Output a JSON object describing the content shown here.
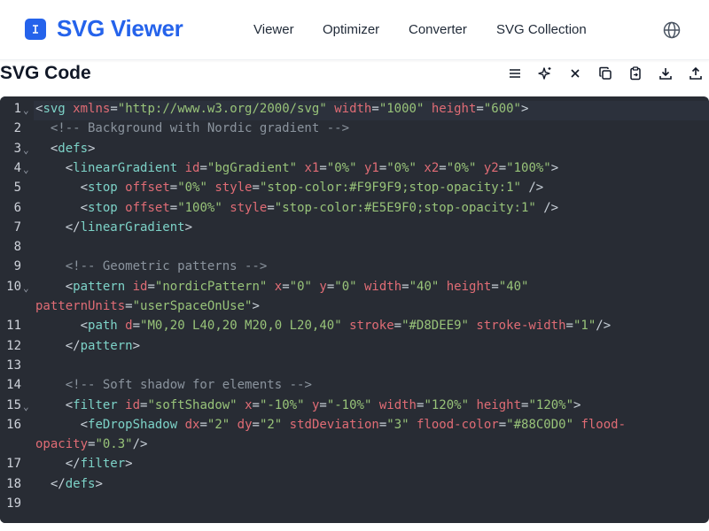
{
  "header": {
    "brand": "SVG Viewer",
    "nav": [
      "Viewer",
      "Optimizer",
      "Converter",
      "SVG Collection"
    ],
    "language_icon": "globe-icon"
  },
  "toolbar": {
    "title": "SVG Code",
    "icons": [
      "menu-icon",
      "sparkles-icon",
      "close-icon",
      "copy-icon",
      "paste-icon",
      "download-icon",
      "upload-icon"
    ]
  },
  "editor": {
    "lines": [
      {
        "n": "1",
        "fold": true
      },
      {
        "n": "2",
        "fold": false
      },
      {
        "n": "3",
        "fold": true
      },
      {
        "n": "4",
        "fold": true
      },
      {
        "n": "5",
        "fold": false
      },
      {
        "n": "6",
        "fold": false
      },
      {
        "n": "7",
        "fold": false
      },
      {
        "n": "8",
        "fold": false
      },
      {
        "n": "9",
        "fold": false
      },
      {
        "n": "10",
        "fold": true
      },
      {
        "n": "11",
        "fold": false
      },
      {
        "n": "12",
        "fold": false
      },
      {
        "n": "13",
        "fold": false
      },
      {
        "n": "14",
        "fold": false
      },
      {
        "n": "15",
        "fold": true
      },
      {
        "n": "16",
        "fold": false
      },
      {
        "n": "17",
        "fold": false
      },
      {
        "n": "18",
        "fold": false
      },
      {
        "n": "19",
        "fold": false
      }
    ],
    "code": [
      [
        [
          "p",
          "<"
        ],
        [
          "tag",
          "svg"
        ],
        [
          "p",
          " "
        ],
        [
          "attr",
          "xmlns"
        ],
        [
          "p",
          "="
        ],
        [
          "str",
          "\"http://www.w3.org/2000/svg\""
        ],
        [
          "p",
          " "
        ],
        [
          "attr",
          "width"
        ],
        [
          "p",
          "="
        ],
        [
          "str",
          "\"1000\""
        ],
        [
          "p",
          " "
        ],
        [
          "attr",
          "height"
        ],
        [
          "p",
          "="
        ],
        [
          "str",
          "\"600\""
        ],
        [
          "p",
          ">"
        ]
      ],
      [
        [
          "p",
          "  "
        ],
        [
          "cmt",
          "<!-- Background with Nordic gradient -->"
        ]
      ],
      [
        [
          "p",
          "  <"
        ],
        [
          "tag",
          "defs"
        ],
        [
          "p",
          ">"
        ]
      ],
      [
        [
          "p",
          "    <"
        ],
        [
          "tag",
          "linearGradient"
        ],
        [
          "p",
          " "
        ],
        [
          "attr",
          "id"
        ],
        [
          "p",
          "="
        ],
        [
          "str",
          "\"bgGradient\""
        ],
        [
          "p",
          " "
        ],
        [
          "attr",
          "x1"
        ],
        [
          "p",
          "="
        ],
        [
          "str",
          "\"0%\""
        ],
        [
          "p",
          " "
        ],
        [
          "attr",
          "y1"
        ],
        [
          "p",
          "="
        ],
        [
          "str",
          "\"0%\""
        ],
        [
          "p",
          " "
        ],
        [
          "attr",
          "x2"
        ],
        [
          "p",
          "="
        ],
        [
          "str",
          "\"0%\""
        ],
        [
          "p",
          " "
        ],
        [
          "attr",
          "y2"
        ],
        [
          "p",
          "="
        ],
        [
          "str",
          "\"100%\""
        ],
        [
          "p",
          ">"
        ]
      ],
      [
        [
          "p",
          "      <"
        ],
        [
          "tag",
          "stop"
        ],
        [
          "p",
          " "
        ],
        [
          "attr",
          "offset"
        ],
        [
          "p",
          "="
        ],
        [
          "str",
          "\"0%\""
        ],
        [
          "p",
          " "
        ],
        [
          "attr",
          "style"
        ],
        [
          "p",
          "="
        ],
        [
          "str",
          "\"stop-color:#F9F9F9;stop-opacity:1\""
        ],
        [
          "p",
          " />"
        ]
      ],
      [
        [
          "p",
          "      <"
        ],
        [
          "tag",
          "stop"
        ],
        [
          "p",
          " "
        ],
        [
          "attr",
          "offset"
        ],
        [
          "p",
          "="
        ],
        [
          "str",
          "\"100%\""
        ],
        [
          "p",
          " "
        ],
        [
          "attr",
          "style"
        ],
        [
          "p",
          "="
        ],
        [
          "str",
          "\"stop-color:#E5E9F0;stop-opacity:1\""
        ],
        [
          "p",
          " />"
        ]
      ],
      [
        [
          "p",
          "    </"
        ],
        [
          "tag",
          "linearGradient"
        ],
        [
          "p",
          ">"
        ]
      ],
      [
        [
          "p",
          ""
        ]
      ],
      [
        [
          "p",
          "    "
        ],
        [
          "cmt",
          "<!-- Geometric patterns -->"
        ]
      ],
      [
        [
          "p",
          "    <"
        ],
        [
          "tag",
          "pattern"
        ],
        [
          "p",
          " "
        ],
        [
          "attr",
          "id"
        ],
        [
          "p",
          "="
        ],
        [
          "str",
          "\"nordicPattern\""
        ],
        [
          "p",
          " "
        ],
        [
          "attr",
          "x"
        ],
        [
          "p",
          "="
        ],
        [
          "str",
          "\"0\""
        ],
        [
          "p",
          " "
        ],
        [
          "attr",
          "y"
        ],
        [
          "p",
          "="
        ],
        [
          "str",
          "\"0\""
        ],
        [
          "p",
          " "
        ],
        [
          "attr",
          "width"
        ],
        [
          "p",
          "="
        ],
        [
          "str",
          "\"40\""
        ],
        [
          "p",
          " "
        ],
        [
          "attr",
          "height"
        ],
        [
          "p",
          "="
        ],
        [
          "str",
          "\"40\""
        ]
      ],
      [
        [
          "attr",
          "patternUnits"
        ],
        [
          "p",
          "="
        ],
        [
          "str",
          "\"userSpaceOnUse\""
        ],
        [
          "p",
          ">"
        ]
      ],
      [
        [
          "p",
          "      <"
        ],
        [
          "tag",
          "path"
        ],
        [
          "p",
          " "
        ],
        [
          "attr",
          "d"
        ],
        [
          "p",
          "="
        ],
        [
          "str",
          "\"M0,20 L40,20 M20,0 L20,40\""
        ],
        [
          "p",
          " "
        ],
        [
          "attr",
          "stroke"
        ],
        [
          "p",
          "="
        ],
        [
          "str",
          "\"#D8DEE9\""
        ],
        [
          "p",
          " "
        ],
        [
          "attr",
          "stroke-width"
        ],
        [
          "p",
          "="
        ],
        [
          "str",
          "\"1\""
        ],
        [
          "p",
          "/>"
        ]
      ],
      [
        [
          "p",
          "    </"
        ],
        [
          "tag",
          "pattern"
        ],
        [
          "p",
          ">"
        ]
      ],
      [
        [
          "p",
          ""
        ]
      ],
      [
        [
          "p",
          "    "
        ],
        [
          "cmt",
          "<!-- Soft shadow for elements -->"
        ]
      ],
      [
        [
          "p",
          "    <"
        ],
        [
          "tag",
          "filter"
        ],
        [
          "p",
          " "
        ],
        [
          "attr",
          "id"
        ],
        [
          "p",
          "="
        ],
        [
          "str",
          "\"softShadow\""
        ],
        [
          "p",
          " "
        ],
        [
          "attr",
          "x"
        ],
        [
          "p",
          "="
        ],
        [
          "str",
          "\"-10%\""
        ],
        [
          "p",
          " "
        ],
        [
          "attr",
          "y"
        ],
        [
          "p",
          "="
        ],
        [
          "str",
          "\"-10%\""
        ],
        [
          "p",
          " "
        ],
        [
          "attr",
          "width"
        ],
        [
          "p",
          "="
        ],
        [
          "str",
          "\"120%\""
        ],
        [
          "p",
          " "
        ],
        [
          "attr",
          "height"
        ],
        [
          "p",
          "="
        ],
        [
          "str",
          "\"120%\""
        ],
        [
          "p",
          ">"
        ]
      ],
      [
        [
          "p",
          "      <"
        ],
        [
          "tag",
          "feDropShadow"
        ],
        [
          "p",
          " "
        ],
        [
          "attr",
          "dx"
        ],
        [
          "p",
          "="
        ],
        [
          "str",
          "\"2\""
        ],
        [
          "p",
          " "
        ],
        [
          "attr",
          "dy"
        ],
        [
          "p",
          "="
        ],
        [
          "str",
          "\"2\""
        ],
        [
          "p",
          " "
        ],
        [
          "attr",
          "stdDeviation"
        ],
        [
          "p",
          "="
        ],
        [
          "str",
          "\"3\""
        ],
        [
          "p",
          " "
        ],
        [
          "attr",
          "flood-color"
        ],
        [
          "p",
          "="
        ],
        [
          "str",
          "\"#88C0D0\""
        ],
        [
          "p",
          " "
        ],
        [
          "attr",
          "flood-"
        ]
      ],
      [
        [
          "attr",
          "opacity"
        ],
        [
          "p",
          "="
        ],
        [
          "str",
          "\"0.3\""
        ],
        [
          "p",
          "/>"
        ]
      ],
      [
        [
          "p",
          "    </"
        ],
        [
          "tag",
          "filter"
        ],
        [
          "p",
          ">"
        ]
      ],
      [
        [
          "p",
          "  </"
        ],
        [
          "tag",
          "defs"
        ],
        [
          "p",
          ">"
        ]
      ],
      [
        [
          "p",
          ""
        ]
      ]
    ],
    "colors": {
      "background": "#282c34",
      "tag": "#7dd3c8",
      "attribute": "#e06c75",
      "string": "#98c379",
      "comment": "#8b949e"
    }
  }
}
